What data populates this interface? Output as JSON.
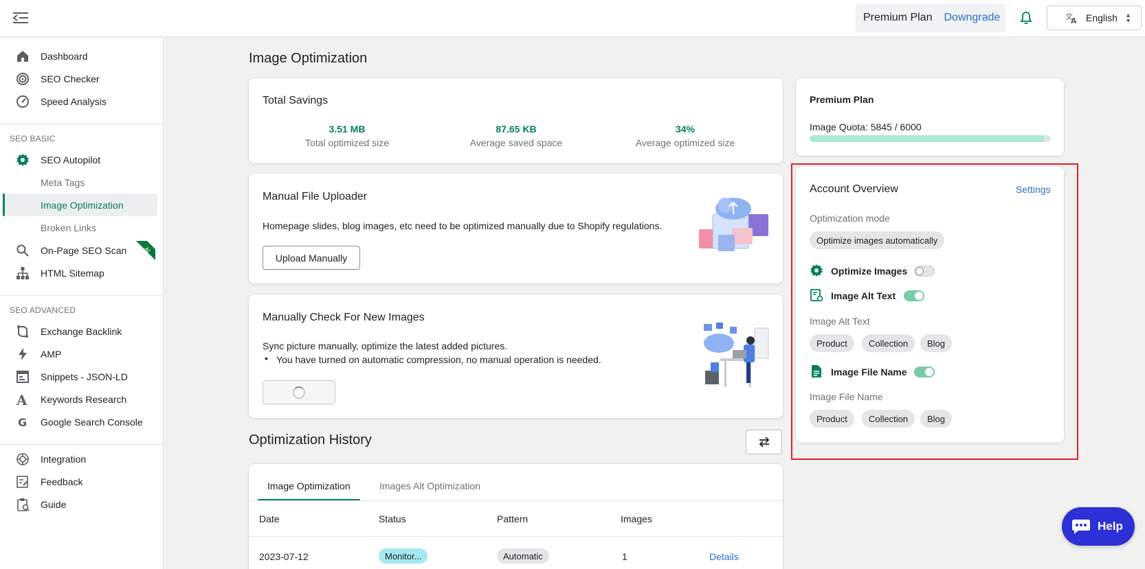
{
  "topbar": {
    "plan_name": "Premium Plan",
    "downgrade_label": "Downgrade",
    "language": "English"
  },
  "sidebar": {
    "items_top": [
      {
        "label": "Dashboard",
        "icon": "home-icon"
      },
      {
        "label": "SEO Checker",
        "icon": "target-icon"
      },
      {
        "label": "Speed Analysis",
        "icon": "speedometer-icon"
      }
    ],
    "section_basic": "SEO BASIC",
    "items_basic": [
      {
        "label": "SEO Autopilot",
        "icon": "gear-icon"
      },
      {
        "label": "Meta Tags"
      },
      {
        "label": "Image Optimization"
      },
      {
        "label": "Broken Links"
      },
      {
        "label": "On-Page SEO Scan",
        "icon": "search-icon",
        "badge": "AI"
      },
      {
        "label": "HTML Sitemap",
        "icon": "sitemap-icon"
      }
    ],
    "section_advanced": "SEO ADVANCED",
    "items_advanced": [
      {
        "label": "Exchange Backlink",
        "icon": "backlink-icon"
      },
      {
        "label": "AMP",
        "icon": "lightning-icon"
      },
      {
        "label": "Snippets - JSON-LD",
        "icon": "snippet-icon"
      },
      {
        "label": "Keywords Research",
        "icon": "letter-a-icon"
      },
      {
        "label": "Google Search Console",
        "icon": "google-icon"
      }
    ],
    "items_bottom": [
      {
        "label": "Integration",
        "icon": "integration-icon"
      },
      {
        "label": "Feedback",
        "icon": "feedback-icon"
      },
      {
        "label": "Guide",
        "icon": "guide-icon"
      }
    ]
  },
  "main": {
    "page_title": "Image Optimization",
    "total_savings": {
      "title": "Total Savings",
      "stats": [
        {
          "value": "3.51 MB",
          "label": "Total optimized size"
        },
        {
          "value": "87.65 KB",
          "label": "Average saved space"
        },
        {
          "value": "34%",
          "label": "Average optimized size"
        }
      ]
    },
    "uploader": {
      "title": "Manual File Uploader",
      "description": "Homepage slides, blog images, etc need to be optimized manually due to Shopify regulations.",
      "button_label": "Upload Manually"
    },
    "check": {
      "title": "Manually Check For New Images",
      "description": "Sync picture manually, optimize the latest added pictures.",
      "bullet": "You have turned on automatic compression, no manual operation is needed."
    },
    "history": {
      "title": "Optimization History",
      "tabs": [
        "Image Optimization",
        "Images Alt Optimization"
      ],
      "columns": [
        "Date",
        "Status",
        "Pattern",
        "Images"
      ],
      "rows": [
        {
          "date": "2023-07-12",
          "status": "Monitor...",
          "pattern": "Automatic",
          "images": "1",
          "action": "Details"
        }
      ]
    }
  },
  "plan_card": {
    "title": "Premium Plan",
    "quota_text": "Image Quota: 5845 / 6000",
    "quota_used": 5845,
    "quota_total": 6000
  },
  "account": {
    "title": "Account Overview",
    "settings_label": "Settings",
    "mode_label": "Optimization mode",
    "mode_value": "Optimize images automatically",
    "features": [
      {
        "label": "Optimize Images",
        "enabled": false
      },
      {
        "label": "Image Alt Text",
        "enabled": true
      },
      {
        "label": "Image File Name",
        "enabled": true
      }
    ],
    "alt_text_label": "Image Alt Text",
    "alt_text_tags": [
      "Product",
      "Collection",
      "Blog"
    ],
    "file_name_label": "Image File Name",
    "file_name_tags": [
      "Product",
      "Collection",
      "Blog"
    ]
  },
  "colors": {
    "brand_green": "#008060",
    "link_blue": "#2c6ecb",
    "highlight_red": "#e0202a",
    "help_blue": "#2d2fd7"
  },
  "help": {
    "label": "Help"
  }
}
